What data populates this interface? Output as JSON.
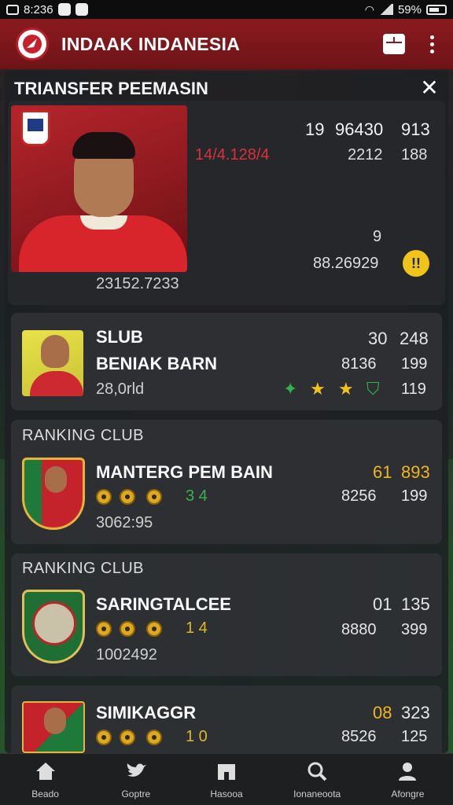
{
  "status_bar": {
    "time": "8:236",
    "battery": "59%"
  },
  "app_bar": {
    "title": "INDAAK INDANESIA",
    "logo_icon": "club-logo-icon",
    "action_icons": [
      "calendar-icon",
      "more-vert-icon"
    ],
    "color": "#7d171c"
  },
  "sheet": {
    "title": "TRIANSFER PEEMASIN",
    "close_label": "✕"
  },
  "hero": {
    "red_value": "14/4.128/4",
    "top_right_a": "19",
    "top_right_b": "96430",
    "top_right_c": "913",
    "mid_a": "2212",
    "mid_b": "188",
    "single": "9",
    "value": "88.26929",
    "coin_label": "!!",
    "bottom_value": "23152.7233"
  },
  "cards": [
    {
      "section": "",
      "title": "SLUB",
      "subtitle": "BENIAK BARN",
      "extra": "28,0rld",
      "n1": "30",
      "n2": "248",
      "n3": "8136",
      "n4": "199",
      "n5": "119",
      "icons": [
        "star-green-icon",
        "star-gold-icon",
        "star-gold-icon",
        "shield-green-icon"
      ]
    },
    {
      "section": "RANKING CLUB",
      "title": "MANTERG PEM BAIN",
      "extra": "3062:95",
      "score": "3 4",
      "n1": "61",
      "n2": "893",
      "n3": "8256",
      "n4": "199"
    },
    {
      "section": "RANKING CLUB",
      "title": "SARINGTALCEE",
      "extra": "1002492",
      "score": "1 4",
      "n1": "01",
      "n2": "135",
      "n3": "8880",
      "n4": "399"
    },
    {
      "section": "",
      "title": "SIMIKAGGR",
      "score": "1 0",
      "n1": "08",
      "n2": "323",
      "n3": "8526",
      "n4": "125"
    }
  ],
  "bottom_nav": [
    {
      "label": "Beado",
      "icon": "home-icon"
    },
    {
      "label": "Goptre",
      "icon": "bird-icon"
    },
    {
      "label": "Hasooa",
      "icon": "building-icon"
    },
    {
      "label": "Ionaneoota",
      "icon": "search-icon"
    },
    {
      "label": "Afongre",
      "icon": "profile-icon"
    }
  ]
}
